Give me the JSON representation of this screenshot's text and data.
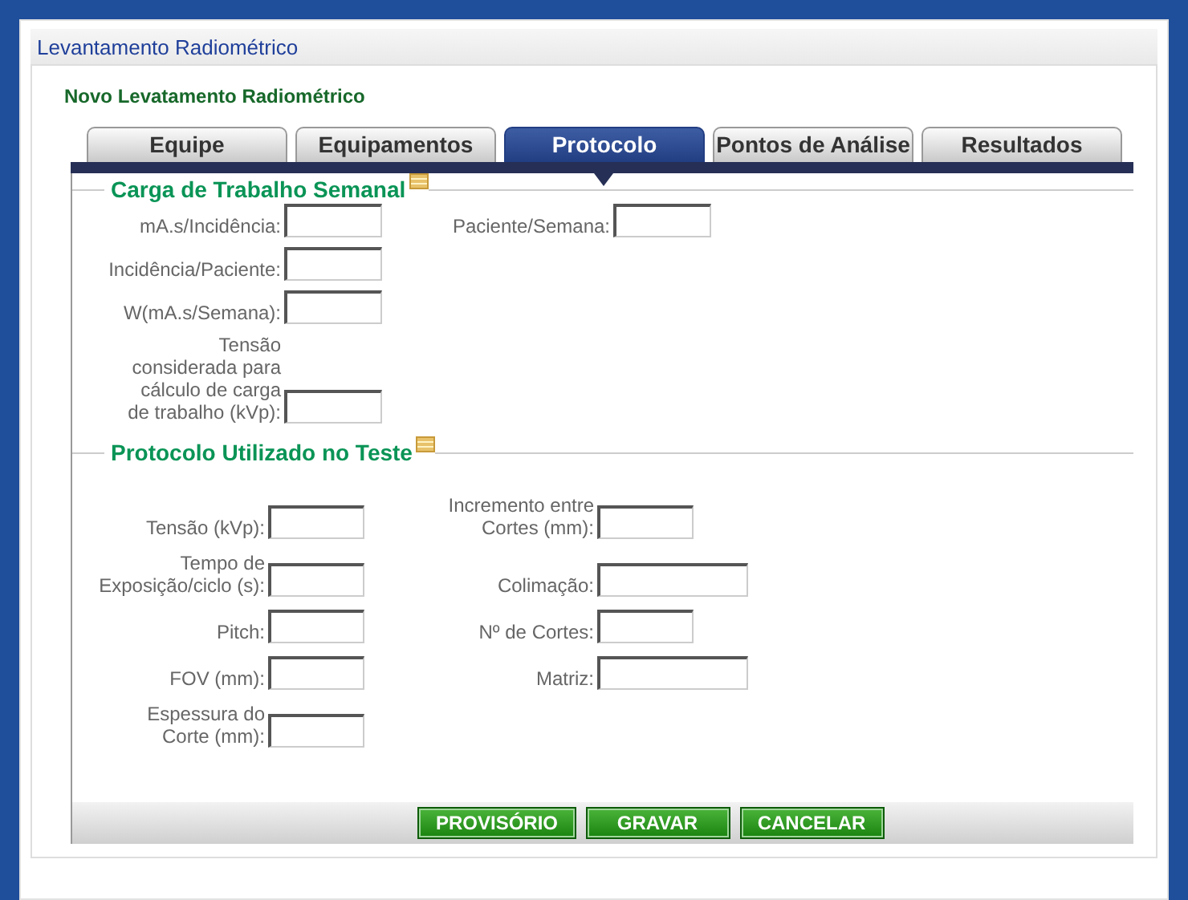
{
  "window": {
    "title": "Levantamento Radiométrico"
  },
  "form": {
    "title": "Novo Levatamento Radiométrico"
  },
  "tabs": [
    {
      "label": "Equipe",
      "selected": false
    },
    {
      "label": "Equipamentos",
      "selected": false
    },
    {
      "label": "Protocolo",
      "selected": true
    },
    {
      "label": "Pontos de Análise",
      "selected": false
    },
    {
      "label": "Resultados",
      "selected": false
    }
  ],
  "sections": [
    {
      "title": "Carga de Trabalho Semanal",
      "rows": [
        {
          "fields": [
            {
              "label": "mA.s/Incidência:",
              "kind": "short"
            },
            {
              "label": "Paciente/Semana:",
              "kind": "short"
            }
          ]
        },
        {
          "fields": [
            {
              "label": "Incidência/Paciente:",
              "kind": "short"
            }
          ]
        },
        {
          "fields": [
            {
              "label": "W(mA.s/Semana):",
              "kind": "short"
            }
          ]
        },
        {
          "fields": [
            {
              "label": "Tensão\nconsiderada para\ncálculo de carga\nde trabalho (kVp):",
              "kind": "short"
            }
          ]
        }
      ]
    },
    {
      "title": "Protocolo Utilizado no Teste",
      "rows": [
        {
          "fields": [
            {
              "label": "Tensão (kVp):",
              "kind": "short"
            },
            {
              "label": "Incremento entre\nCortes (mm):",
              "kind": "short"
            }
          ]
        },
        {
          "fields": [
            {
              "label": "Tempo de\nExposição/ciclo (s):",
              "kind": "short"
            },
            {
              "label": "Colimação:",
              "kind": "wide"
            }
          ]
        },
        {
          "fields": [
            {
              "label": "Pitch:",
              "kind": "short"
            },
            {
              "label": "Nº de Cortes:",
              "kind": "short"
            }
          ]
        },
        {
          "fields": [
            {
              "label": "FOV (mm):",
              "kind": "short"
            },
            {
              "label": "Matriz:",
              "kind": "wide"
            }
          ]
        },
        {
          "fields": [
            {
              "label": "Espessura do\nCorte (mm):",
              "kind": "short"
            }
          ]
        }
      ]
    }
  ],
  "buttons": [
    "PROVISÓRIO",
    "GRAVAR",
    "CANCELAR"
  ]
}
